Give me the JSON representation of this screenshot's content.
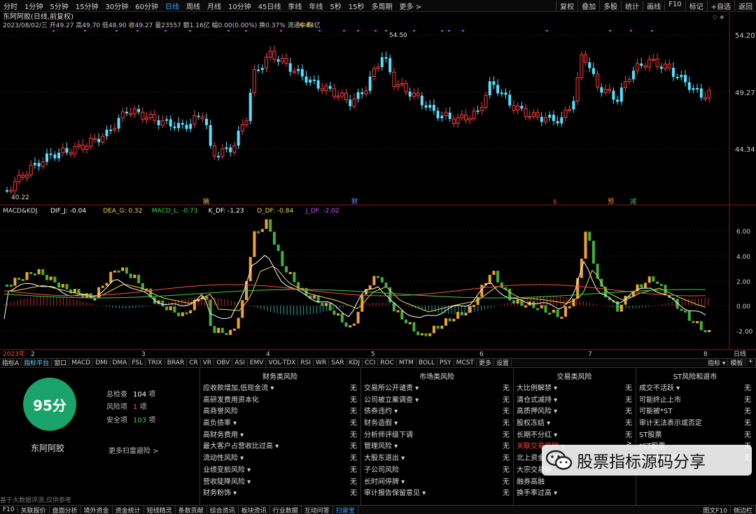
{
  "toolbar": {
    "periods": [
      "分时",
      "1分钟",
      "5分钟",
      "15分钟",
      "30分钟",
      "60分钟",
      "日线",
      "周线",
      "月线",
      "10分钟",
      "45日线",
      "季线",
      "年线",
      "5秒",
      "15秒",
      "多周期",
      "更多 >"
    ],
    "active_period": "日线",
    "right_buttons": [
      "复权",
      "叠加",
      "多股",
      "统计",
      "画线",
      "F10",
      "标记",
      "+自选",
      "返回"
    ]
  },
  "header": {
    "title": "东阿阿胶(日线,前复权)",
    "quote": "2023/08/02/三 开49.27 高49.70 低48.90 收49.27 量23557 额1.16亿 幅0.00(0.00%) 换0.37% 流通6.44亿",
    "sector": "中药"
  },
  "price_axis": {
    "labels": [
      "54.20",
      "49.27",
      "44.34"
    ],
    "high_marker": "54.50",
    "low_marker": "40.22"
  },
  "event_markers": [
    "摘",
    "财",
    "$",
    "预",
    "减"
  ],
  "indicator": {
    "name": "MACD&KDJ",
    "params": [
      {
        "text": "DIF_J: -0.04",
        "color": "#ffffff"
      },
      {
        "text": "DEA_G: 0.32",
        "color": "#e8d84a"
      },
      {
        "text": "MACD_L: -0.73",
        "color": "#3fcf3f"
      },
      {
        "text": "K_DF: -1.23",
        "color": "#ffffff"
      },
      {
        "text": "D_DF: -0.84",
        "color": "#e8d84a"
      },
      {
        "text": "J_DF: -2.02",
        "color": "#d050ff"
      }
    ],
    "axis_labels": [
      "6.00",
      "4.00",
      "2.00",
      "0.00",
      "-2.00"
    ]
  },
  "time_axis": {
    "labels": [
      "2023年",
      "2",
      "3",
      "4",
      "5",
      "6",
      "7",
      "8"
    ],
    "period_label": "日线"
  },
  "indicator_tabs": {
    "items": [
      "指标A",
      "指标平台",
      "窗口",
      "MACD",
      "DMI",
      "DMA",
      "FSL",
      "TRIX",
      "BRAR",
      "CR",
      "VR",
      "OBV",
      "ASI",
      "EMV",
      "VOL-TDX",
      "RSI",
      "WR",
      "SAR",
      "KDJ",
      "CCI",
      "ROC",
      "MTM",
      "BOLL",
      "PSY",
      "MCST",
      "更多",
      "设置"
    ],
    "active": "指标平台",
    "right": [
      "指标 ▾",
      "模板",
      "+"
    ]
  },
  "scan": {
    "score": "95分",
    "stock_name": "东阿阿胶",
    "total_label": "总检查",
    "total_value": "104",
    "total_unit": "项",
    "risk_label": "风险项",
    "risk_value": "1",
    "risk_unit": "项",
    "safe_label": "安全项",
    "safe_value": "103",
    "safe_unit": "项",
    "more_link": "更多扫雷避险 >",
    "footnote": "基于大数据评测,仅供参考",
    "columns": [
      {
        "title": "财务类风险",
        "rows": [
          {
            "label": "应收款增加,低现金流 ▾",
            "value": "无"
          },
          {
            "label": "高研发费用资本化",
            "value": "无"
          },
          {
            "label": "高商誉风险",
            "value": "无"
          },
          {
            "label": "高负债率 ▾",
            "value": "无"
          },
          {
            "label": "高财务费用 ▾",
            "value": "无"
          },
          {
            "label": "最大客户占营收比过高 ▾",
            "value": "无"
          },
          {
            "label": "流动性风险 ▾",
            "value": "无"
          },
          {
            "label": "业绩变脸风险 ▾",
            "value": "无"
          },
          {
            "label": "营收陡降风险 ▾",
            "value": "无"
          },
          {
            "label": "财务粉饰 ▾",
            "value": "无"
          }
        ]
      },
      {
        "title": "市场类风险",
        "rows": [
          {
            "label": "交易所公开谴责 ▾",
            "value": "无"
          },
          {
            "label": "公司被立案调查 ▾",
            "value": "无"
          },
          {
            "label": "债券违约 ▾",
            "value": "无"
          },
          {
            "label": "财务造假 ▾",
            "value": "无"
          },
          {
            "label": "分析师评级下调",
            "value": "无"
          },
          {
            "label": "管理风险 ▾",
            "value": "无"
          },
          {
            "label": "大股东退出 ▾",
            "value": "无"
          },
          {
            "label": "子公司风险",
            "value": "无"
          },
          {
            "label": "长时间停牌 ▾",
            "value": "无"
          },
          {
            "label": "审计报告保留意见 ▾",
            "value": "无"
          }
        ]
      },
      {
        "title": "交易类风险",
        "rows": [
          {
            "label": "大比例解禁 ▾",
            "value": "无"
          },
          {
            "label": "清仓式减持 ▾",
            "value": "无"
          },
          {
            "label": "高质押风险 ▾",
            "value": "无"
          },
          {
            "label": "股权冻结 ▾",
            "value": "无"
          },
          {
            "label": "长期不分红 ▾",
            "value": "无"
          },
          {
            "label": "关联交易风险 ▾",
            "value": ">",
            "highlight": true
          },
          {
            "label": "北上资金卖出",
            "value": "无"
          },
          {
            "label": "大宗交易折",
            "value": ""
          },
          {
            "label": "融券高融",
            "value": ""
          },
          {
            "label": "换手率过高 ▾",
            "value": ""
          }
        ]
      },
      {
        "title": "ST风险和退市",
        "rows": [
          {
            "label": "成交不活跃 ▾",
            "value": "无"
          },
          {
            "label": "可能终止上市",
            "value": "无"
          },
          {
            "label": "可能被*ST",
            "value": "无"
          },
          {
            "label": "审计无法表示或否定",
            "value": "无"
          },
          {
            "label": "ST股票",
            "value": "无"
          },
          {
            "label": "*ST股票",
            "value": "无"
          },
          {
            "label": "进入退市整理",
            "value": "无"
          }
        ]
      }
    ]
  },
  "watermark": {
    "text": "股票指标源码分享",
    "icon": "wechat-icon"
  },
  "bottom_tabs": {
    "items": [
      "F10",
      "关联报价",
      "盘面分析",
      "境外资金",
      "资金统计",
      "短线精灵",
      "条数贡献",
      "综合资讯",
      "板块资讯",
      "行业数据",
      "互动问答",
      "扫雷宝"
    ],
    "active": "扫雷宝",
    "right": [
      "图文F10",
      "侧边栏"
    ]
  },
  "colors": {
    "up": "#ff3b3b",
    "down": "#54e0ff",
    "kdj_up": "#f0a030",
    "kdj_down": "#3faf3f",
    "score": "#1aa36a",
    "accent": "#39a0ff"
  }
}
